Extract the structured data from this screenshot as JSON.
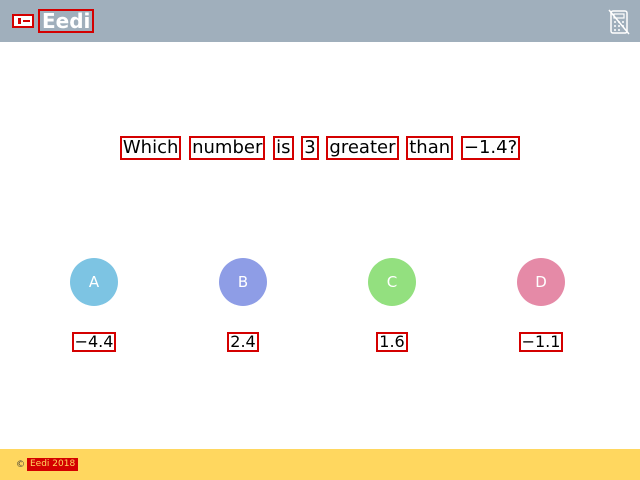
{
  "header": {
    "brand": "Eedi",
    "calculator_icon": "calculator-crossed-icon"
  },
  "question": {
    "words": [
      "Which",
      "number",
      "is",
      "3",
      "greater",
      "than",
      "−1.4?"
    ]
  },
  "options": [
    {
      "letter": "A",
      "value": "−4.4",
      "color": "#7dc4e3"
    },
    {
      "letter": "B",
      "value": "2.4",
      "color": "#8e9de6"
    },
    {
      "letter": "C",
      "value": "1.6",
      "color": "#93e07f"
    },
    {
      "letter": "D",
      "value": "−1.1",
      "color": "#e58aa7"
    }
  ],
  "footer": {
    "copyright_symbol": "©",
    "copyright_text": "Eedi 2018"
  },
  "colors": {
    "header_bg": "#a0afbc",
    "footer_bg": "#ffd75f",
    "highlight": "#d40000"
  }
}
